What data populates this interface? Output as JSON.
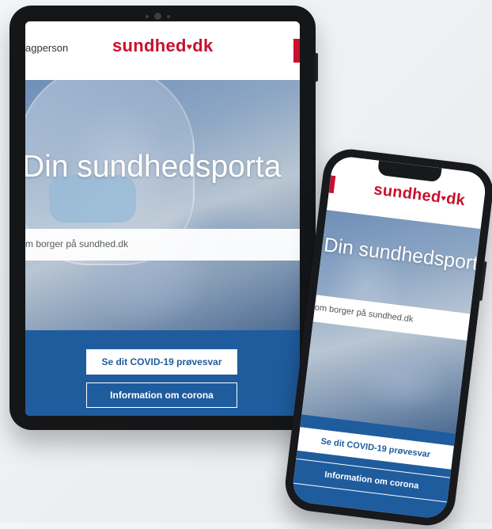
{
  "tablet": {
    "nav_link": "agperson",
    "logo_text": "sundhed",
    "logo_suffix": "dk",
    "hero_title": "Din sundhedsporta",
    "search_placeholder": "m borger på sundhed.dk",
    "primary_button": "Se dit COVID-19 prøvesvar",
    "secondary_button": "Information om corona"
  },
  "phone": {
    "logo_text": "sundhed",
    "logo_suffix": "dk",
    "hero_title": "Din sundhedsporta",
    "search_placeholder": "om borger på sundhed.dk",
    "primary_button": "Se dit COVID-19 prøvesvar",
    "secondary_button": "Information om corona"
  },
  "colors": {
    "brand_red": "#c8102e",
    "brand_blue": "#1f5c9e"
  },
  "icons": {
    "logo_heart": "heart-icon"
  }
}
